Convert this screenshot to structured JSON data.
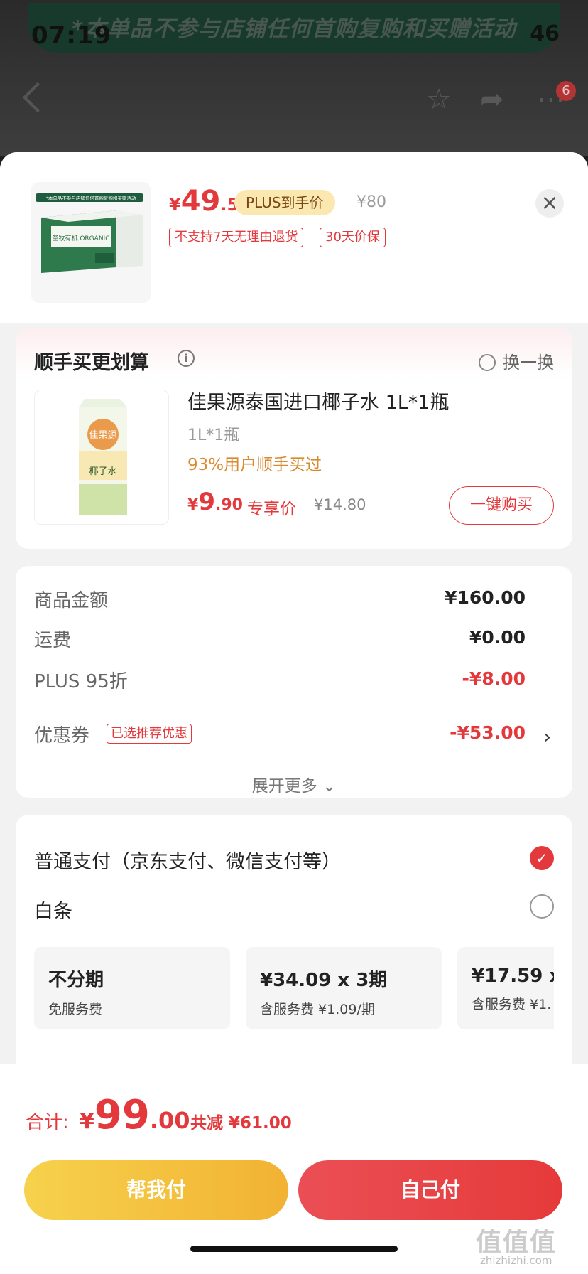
{
  "background": {
    "banner_text": "*本单品不参与店铺任何首购复购和买赠活动",
    "status_time": "07:19",
    "status_right": "46",
    "cart_badge": "6"
  },
  "product": {
    "image_banner": "*本单品不参与店铺任何首购复购和买赠活动",
    "image_brand": "圣牧有机 ORGANIC",
    "price_symbol": "¥",
    "price_int": "49",
    "price_dec": ".5",
    "plus_label": "PLUS到手价",
    "original_price": "¥80",
    "tag_no_return": "不支持7天无理由退货",
    "tag_price_protect": "30天价保"
  },
  "addon": {
    "title": "顺手买更划算",
    "swap_label": "换一换",
    "image_brand": "佳果源",
    "image_name": "椰子水",
    "name": "佳果源泰国进口椰子水 1L*1瓶",
    "spec": "1L*1瓶",
    "buyers": "93%用户顺手买过",
    "price_symbol": "¥",
    "price_int": "9",
    "price_dec": ".90",
    "exclusive_label": "专享价",
    "original_price": "¥14.80",
    "buy_button": "一键购买"
  },
  "summary": {
    "rows": [
      {
        "label": "商品金额",
        "value": "¥160.00"
      },
      {
        "label": "运费",
        "value": "¥0.00"
      },
      {
        "label": "PLUS 95折",
        "value": "-¥8.00"
      },
      {
        "label": "优惠券",
        "value": "-¥53.00"
      }
    ],
    "coupon_tag": "已选推荐优惠",
    "expand_label": "展开更多 ⌄"
  },
  "payment": {
    "normal_label": "普通支付（京东支付、微信支付等）",
    "baitiao_label": "白条",
    "plans": [
      {
        "title": "不分期",
        "sub": "免服务费"
      },
      {
        "title": "¥34.09 x 3期",
        "sub": "含服务费 ¥1.09/期"
      },
      {
        "title": "¥17.59 x",
        "sub": "含服务费 ¥1."
      }
    ]
  },
  "checkout": {
    "total_label": "合计:",
    "total_symbol": "¥",
    "total_int": "99",
    "total_dec": ".00",
    "saved": "共减 ¥61.00",
    "help_pay": "帮我付",
    "self_pay": "自己付"
  },
  "watermark": {
    "text": "值值值",
    "sub": "zhizhizhi.com"
  },
  "colors": {
    "accent_red": "#e4393c",
    "gold": "#f2b233"
  }
}
